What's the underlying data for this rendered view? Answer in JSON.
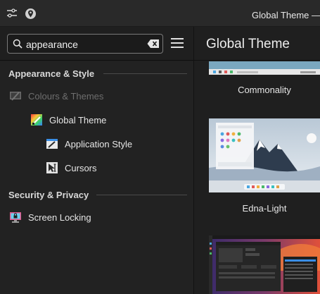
{
  "window": {
    "title": "Global Theme —"
  },
  "search": {
    "value": "appearance",
    "placeholder": "Search…"
  },
  "header": {
    "page_title": "Global Theme"
  },
  "sidebar": {
    "sections": [
      {
        "label": "Appearance & Style",
        "items": [
          {
            "label": "Colours & Themes",
            "icon": "colours-themes-icon",
            "state": "dimmed"
          },
          {
            "label": "Global Theme",
            "icon": "global-theme-icon",
            "state": "selected"
          },
          {
            "label": "Application Style",
            "icon": "application-style-icon",
            "state": "normal"
          },
          {
            "label": "Cursors",
            "icon": "cursors-icon",
            "state": "normal"
          }
        ]
      },
      {
        "label": "Security & Privacy",
        "items": [
          {
            "label": "Screen Locking",
            "icon": "screen-locking-icon",
            "state": "normal"
          }
        ]
      }
    ]
  },
  "themes": [
    {
      "name": "Commonality"
    },
    {
      "name": "Edna-Light"
    },
    {
      "name": ""
    }
  ],
  "colors": {
    "window_bg": "#1f1f1f",
    "sidebar_bg": "#222222",
    "titlebar_bg": "#292929",
    "text": "#e6e6e6",
    "dim_text": "#6e6e6e",
    "border": "#7a7a7a"
  }
}
